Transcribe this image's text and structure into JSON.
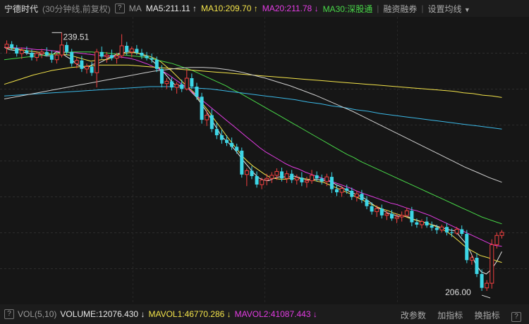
{
  "header": {
    "stock_name": "宁德时代",
    "period": "(30分钟线,前复权)",
    "help_icon": "?",
    "ma_label": "MA",
    "ma5": "MA5:211.11",
    "ma5_arrow": "↑",
    "ma10": "MA10:209.70",
    "ma10_arrow": "↑",
    "ma20": "MA20:211.78",
    "ma20_arrow": "↓",
    "ma30": "MA30:深股通",
    "btn_margin": "融资融券",
    "btn_settings": "设置均线",
    "settings_caret": "▼"
  },
  "footer": {
    "vol_help": "?",
    "vol_name": "VOL(5,10)",
    "volume": "VOLUME:12076.430",
    "volume_arrow": "↓",
    "mavol1": "MAVOL1:46770.286",
    "mavol1_arrow": "↓",
    "mavol2": "MAVOL2:41087.443",
    "mavol2_arrow": "↓",
    "btn_params": "改参数",
    "btn_add_indicator": "加指标",
    "btn_switch_indicator": "换指标",
    "footer_help": "?"
  },
  "chart_data": {
    "type": "candlestick",
    "high_label": "239.51",
    "low_label": "206.00",
    "colors": {
      "up": "#f24040",
      "down": "#3dd6e6",
      "ma5": "#e8e8e8",
      "ma10": "#f4e44a",
      "ma20": "#e43ce4",
      "ma30": "#48d848",
      "ma60": "#f4e44a",
      "ma120": "#3bb8e6",
      "ma250": "#d0d0d0"
    },
    "ylim": [
      205.0,
      241.0
    ],
    "grid": true,
    "candles": [
      [
        237.6,
        238.5,
        236.8,
        238.0
      ],
      [
        238.0,
        238.4,
        237.2,
        237.5
      ],
      [
        237.5,
        237.9,
        236.4,
        236.8
      ],
      [
        236.8,
        237.6,
        236.1,
        237.2
      ],
      [
        237.2,
        237.7,
        236.6,
        236.9
      ],
      [
        236.9,
        237.3,
        235.9,
        236.3
      ],
      [
        236.3,
        237.1,
        235.8,
        236.8
      ],
      [
        236.8,
        237.4,
        236.2,
        237.0
      ],
      [
        237.0,
        237.6,
        236.4,
        236.6
      ],
      [
        236.6,
        237.2,
        235.6,
        236.0
      ],
      [
        236.0,
        236.9,
        235.5,
        236.6
      ],
      [
        236.6,
        239.51,
        236.3,
        237.9
      ],
      [
        237.9,
        238.3,
        236.6,
        237.0
      ],
      [
        237.0,
        237.4,
        235.1,
        235.5
      ],
      [
        235.5,
        236.3,
        234.9,
        235.9
      ],
      [
        235.9,
        236.5,
        234.4,
        234.8
      ],
      [
        234.8,
        235.5,
        234.2,
        235.1
      ],
      [
        235.1,
        235.7,
        233.9,
        234.3
      ],
      [
        234.3,
        237.4,
        232.4,
        237.0
      ],
      [
        237.0,
        237.7,
        236.1,
        236.4
      ],
      [
        236.4,
        237.0,
        235.6,
        236.6
      ],
      [
        236.6,
        237.3,
        235.9,
        236.2
      ],
      [
        236.2,
        236.9,
        235.5,
        236.5
      ],
      [
        236.5,
        239.3,
        236.2,
        237.8
      ],
      [
        237.8,
        238.3,
        236.6,
        237.0
      ],
      [
        237.0,
        237.7,
        236.3,
        237.4
      ],
      [
        237.4,
        237.9,
        236.6,
        236.9
      ],
      [
        236.9,
        237.4,
        236.1,
        236.5
      ],
      [
        236.5,
        237.0,
        235.9,
        236.2
      ],
      [
        236.2,
        236.8,
        235.6,
        236.0
      ],
      [
        236.0,
        236.4,
        234.4,
        234.8
      ],
      [
        234.8,
        235.3,
        232.4,
        232.9
      ],
      [
        232.9,
        233.6,
        232.2,
        233.2
      ],
      [
        233.2,
        233.7,
        232.0,
        232.4
      ],
      [
        232.4,
        233.1,
        231.6,
        232.8
      ],
      [
        232.8,
        233.4,
        231.8,
        232.2
      ],
      [
        232.2,
        234.8,
        232.0,
        233.6
      ],
      [
        233.6,
        234.2,
        232.2,
        232.5
      ],
      [
        232.5,
        233.0,
        230.8,
        231.2
      ],
      [
        231.2,
        231.7,
        227.7,
        228.2
      ],
      [
        228.2,
        229.4,
        227.4,
        228.8
      ],
      [
        228.8,
        229.6,
        226.6,
        227.0
      ],
      [
        227.0,
        227.8,
        225.7,
        226.2
      ],
      [
        226.2,
        226.9,
        225.1,
        225.6
      ],
      [
        225.6,
        226.2,
        224.8,
        225.2
      ],
      [
        225.2,
        225.9,
        224.3,
        224.7
      ],
      [
        224.7,
        225.1,
        223.8,
        224.2
      ],
      [
        224.2,
        224.6,
        220.7,
        221.1
      ],
      [
        221.1,
        221.9,
        219.6,
        221.6
      ],
      [
        221.6,
        222.2,
        220.5,
        220.9
      ],
      [
        220.9,
        221.5,
        219.4,
        219.8
      ],
      [
        219.8,
        220.7,
        219.2,
        220.4
      ],
      [
        220.4,
        221.2,
        219.7,
        220.6
      ],
      [
        220.6,
        221.4,
        220.0,
        221.0
      ],
      [
        221.0,
        221.9,
        220.4,
        221.5
      ],
      [
        221.5,
        222.0,
        220.2,
        220.6
      ],
      [
        220.6,
        221.6,
        220.0,
        221.2
      ],
      [
        221.2,
        221.7,
        220.0,
        220.4
      ],
      [
        220.4,
        221.1,
        219.8,
        220.7
      ],
      [
        220.7,
        221.4,
        219.6,
        220.1
      ],
      [
        220.1,
        220.8,
        219.4,
        220.3
      ],
      [
        220.3,
        221.7,
        219.9,
        221.0
      ],
      [
        221.0,
        221.5,
        220.2,
        220.6
      ],
      [
        220.6,
        221.1,
        219.8,
        220.2
      ],
      [
        220.2,
        221.2,
        219.6,
        220.8
      ],
      [
        220.8,
        221.4,
        218.7,
        219.2
      ],
      [
        219.2,
        219.8,
        218.3,
        218.8
      ],
      [
        218.8,
        219.6,
        218.2,
        219.3
      ],
      [
        219.3,
        219.8,
        218.6,
        219.0
      ],
      [
        219.0,
        219.4,
        217.8,
        218.2
      ],
      [
        218.2,
        219.0,
        217.6,
        218.6
      ],
      [
        218.6,
        219.1,
        217.4,
        217.8
      ],
      [
        217.8,
        218.3,
        216.6,
        217.0
      ],
      [
        217.0,
        217.5,
        215.9,
        216.3
      ],
      [
        216.3,
        217.1,
        215.6,
        216.7
      ],
      [
        216.7,
        217.2,
        215.4,
        215.8
      ],
      [
        215.8,
        216.4,
        215.2,
        216.0
      ],
      [
        216.0,
        216.5,
        215.1,
        215.4
      ],
      [
        215.4,
        216.0,
        214.8,
        215.6
      ],
      [
        215.6,
        216.3,
        215.0,
        215.8
      ],
      [
        215.8,
        216.8,
        215.6,
        216.4
      ],
      [
        216.4,
        216.9,
        214.4,
        214.9
      ],
      [
        214.9,
        215.4,
        214.2,
        214.6
      ],
      [
        214.6,
        215.3,
        214.1,
        215.0
      ],
      [
        215.0,
        215.6,
        214.2,
        214.5
      ],
      [
        214.5,
        215.0,
        213.8,
        214.2
      ],
      [
        214.2,
        214.6,
        213.4,
        213.9
      ],
      [
        213.9,
        214.6,
        213.6,
        214.3
      ],
      [
        214.3,
        214.8,
        213.2,
        213.6
      ],
      [
        213.6,
        214.1,
        213.0,
        213.5
      ],
      [
        213.5,
        214.3,
        213.3,
        214.0
      ],
      [
        214.0,
        214.5,
        213.1,
        213.4
      ],
      [
        213.4,
        213.9,
        209.6,
        210.0
      ],
      [
        210.0,
        210.7,
        209.4,
        210.3
      ],
      [
        210.3,
        210.9,
        207.8,
        208.2
      ],
      [
        208.2,
        208.8,
        206.0,
        206.4
      ],
      [
        206.4,
        207.4,
        206.0,
        207.0
      ],
      [
        207.0,
        212.7,
        206.3,
        212.0
      ],
      [
        212.0,
        213.6,
        211.5,
        213.2
      ],
      [
        213.2,
        213.9,
        212.8,
        213.6
      ]
    ],
    "ma_series": [
      {
        "name": "MA5",
        "values": [
          237.6,
          237.3,
          237.2,
          237.3,
          236.9,
          236.8,
          236.8,
          236.7,
          236.5,
          236.5,
          237.0,
          236.9,
          236.4,
          236.0,
          235.4,
          235.1,
          234.9,
          235.4,
          235.5,
          235.8,
          236.2,
          236.5,
          236.8,
          236.9,
          237.1,
          237.0,
          236.8,
          236.5,
          236.2,
          235.6,
          234.8,
          234.2,
          233.4,
          232.7,
          232.6,
          232.6,
          231.9,
          231.2,
          230.3,
          229.3,
          228.2,
          227.1,
          226.0,
          225.4,
          224.7,
          223.9,
          223.0,
          222.2,
          221.4,
          220.7,
          220.4,
          220.3,
          220.6,
          220.8,
          220.8,
          220.8,
          220.9,
          220.7,
          220.5,
          220.4,
          220.5,
          220.4,
          220.3,
          220.2,
          219.8,
          219.5,
          219.1,
          218.8,
          218.5,
          218.2,
          217.8,
          217.3,
          216.8,
          216.5,
          216.1,
          215.9,
          215.7,
          215.7,
          215.6,
          215.3,
          215.1,
          214.9,
          214.7,
          214.5,
          214.3,
          214.1,
          213.9,
          213.8,
          213.0,
          212.2,
          211.0,
          209.4,
          208.5,
          208.2,
          208.8,
          209.8,
          211.1
        ]
      },
      {
        "name": "MA10",
        "values": [
          237.6,
          237.5,
          237.4,
          237.3,
          237.2,
          237.1,
          237.0,
          236.9,
          236.8,
          236.7,
          236.8,
          236.7,
          236.6,
          236.4,
          236.2,
          236.0,
          235.8,
          235.9,
          236.0,
          236.0,
          236.3,
          236.6,
          236.8,
          236.9,
          236.9,
          236.8,
          236.6,
          236.4,
          236.1,
          235.7,
          235.1,
          234.5,
          233.8,
          233.1,
          232.4,
          231.8,
          230.9,
          230.0,
          229.1,
          228.1,
          227.2,
          226.2,
          225.3,
          224.4,
          223.5,
          222.8,
          222.2,
          221.7,
          221.2,
          220.8,
          220.6,
          220.5,
          220.5,
          220.6,
          220.6,
          220.6,
          220.5,
          220.4,
          220.2,
          220.1,
          219.8,
          219.5,
          219.2,
          218.9,
          218.6,
          218.2,
          217.9,
          217.5,
          217.2,
          216.9,
          216.6,
          216.4,
          216.1,
          215.9,
          215.7,
          215.4,
          215.2,
          215.0,
          214.8,
          214.6,
          214.3,
          214.0,
          213.6,
          213.1,
          212.5,
          211.9,
          211.4,
          211.0,
          210.6,
          210.4,
          210.2,
          209.9,
          209.7
        ]
      },
      {
        "name": "MA20",
        "values": [
          237.6,
          237.6,
          237.5,
          237.5,
          237.4,
          237.3,
          237.3,
          237.2,
          237.1,
          237.0,
          236.9,
          236.9,
          236.8,
          236.7,
          236.6,
          236.5,
          236.5,
          236.4,
          236.3,
          236.2,
          236.0,
          235.7,
          235.4,
          235.0,
          234.6,
          234.1,
          233.5,
          232.9,
          232.3,
          231.6,
          230.9,
          230.2,
          229.5,
          228.8,
          228.1,
          227.4,
          226.7,
          226.0,
          225.3,
          224.6,
          224.0,
          223.5,
          223.0,
          222.5,
          222.1,
          221.8,
          221.4,
          221.1,
          220.8,
          220.5,
          220.2,
          219.9,
          219.6,
          219.3,
          218.9,
          218.6,
          218.3,
          218.0,
          217.7,
          217.4,
          217.2,
          216.9,
          216.6,
          216.4,
          216.1,
          215.8,
          215.4,
          215.0,
          214.6,
          214.2,
          213.8,
          213.4,
          213.0,
          212.6,
          212.2,
          211.9,
          211.8
        ]
      },
      {
        "name": "MA30",
        "values": [
          236.0,
          236.1,
          236.2,
          236.3,
          236.4,
          236.5,
          236.6,
          236.7,
          236.8,
          236.9,
          237.0,
          237.0,
          237.0,
          237.0,
          236.9,
          236.9,
          236.8,
          236.7,
          236.6,
          236.5,
          236.4,
          236.3,
          236.1,
          235.9,
          235.7,
          235.5,
          235.2,
          234.9,
          234.6,
          234.2,
          233.8,
          233.4,
          233.0,
          232.6,
          232.1,
          231.7,
          231.2,
          230.7,
          230.2,
          229.7,
          229.2,
          228.7,
          228.2,
          227.7,
          227.2,
          226.7,
          226.2,
          225.7,
          225.2,
          224.7,
          224.2,
          223.7,
          223.3,
          222.8,
          222.4,
          222.0,
          221.6,
          221.2,
          220.8,
          220.4,
          220.0,
          219.6,
          219.2,
          218.8,
          218.4,
          218.0,
          217.6,
          217.2,
          216.8,
          216.4,
          216.0,
          215.6,
          215.3,
          215.0,
          214.7
        ]
      },
      {
        "name": "MA60",
        "values": [
          232.8,
          233.2,
          233.6,
          234.0,
          234.3,
          234.6,
          234.8,
          235.0,
          235.1,
          235.2,
          235.3,
          235.3,
          235.3,
          235.3,
          235.2,
          235.1,
          235.0,
          234.9,
          234.8,
          234.7,
          234.6,
          234.5,
          234.4,
          234.3,
          234.2,
          234.1,
          234.0,
          233.9,
          233.8,
          233.7,
          233.6,
          233.5,
          233.4,
          233.3,
          233.2,
          233.1,
          233.0,
          232.9,
          232.8,
          232.7,
          232.6,
          232.5,
          232.4,
          232.3,
          232.2,
          232.1,
          232.0,
          231.9,
          231.7,
          231.6,
          231.4,
          231.3,
          231.1
        ]
      },
      {
        "name": "MA120",
        "values": [
          231.3,
          231.4,
          231.5,
          231.6,
          231.7,
          231.8,
          231.9,
          232.0,
          232.1,
          232.2,
          232.3,
          232.4,
          232.5,
          232.5,
          232.5,
          232.4,
          232.3,
          232.2,
          232.0,
          231.8,
          231.6,
          231.4,
          231.2,
          231.0,
          230.8,
          230.5,
          230.3,
          230.0,
          229.8,
          229.5,
          229.3,
          229.0,
          228.8,
          228.6,
          228.4,
          228.2,
          228.0,
          227.8,
          227.6,
          227.4,
          227.2,
          227.0
        ]
      },
      {
        "name": "MA250",
        "values": [
          230.9,
          231.2,
          231.5,
          231.8,
          232.1,
          232.4,
          232.7,
          233.0,
          233.3,
          233.6,
          233.9,
          234.2,
          234.5,
          234.7,
          234.9,
          235.0,
          235.0,
          234.9,
          234.7,
          234.4,
          234.0,
          233.6,
          233.1,
          232.6,
          232.0,
          231.4,
          230.7,
          230.0,
          229.3,
          228.5,
          227.7,
          226.9,
          226.1,
          225.3,
          224.5,
          223.7,
          222.9,
          222.1,
          221.4,
          220.7,
          220.1
        ]
      }
    ]
  }
}
